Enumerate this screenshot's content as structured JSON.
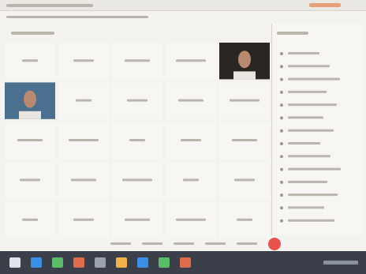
{
  "note_for_reader": "",
  "palette": {
    "accent": "#e8524a",
    "taskbar": "#3a3f4a",
    "screen_bg": "#f4f3ef",
    "tile_bg": "#f7f6f2"
  },
  "counts": {
    "grid_columns": 5,
    "grid_rows": 5,
    "sidebar_rows": 14,
    "control_buttons": 5,
    "taskbar_icons": 9
  },
  "icons": {
    "record_button": "circle-icon",
    "taskbar": [
      "windows-icon",
      "folder-icon",
      "browser-icon",
      "store-icon",
      "mail-icon",
      "app-icon",
      "app-icon",
      "app-icon",
      "app-icon"
    ]
  }
}
